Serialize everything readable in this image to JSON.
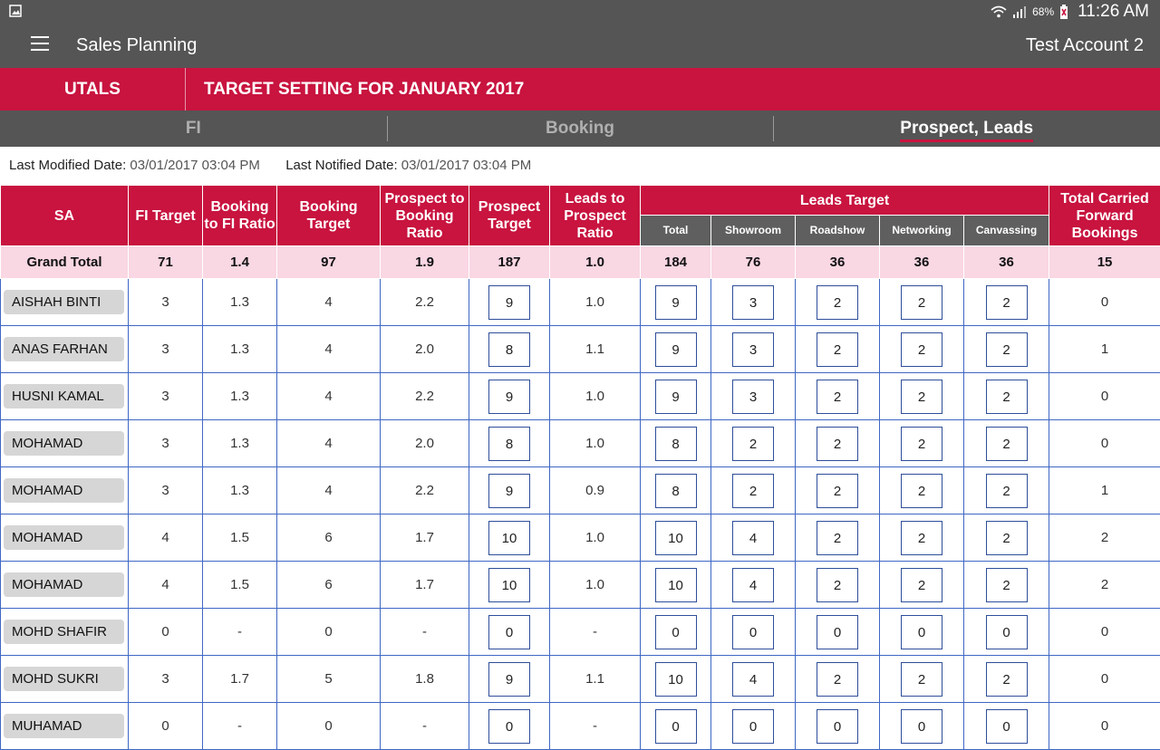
{
  "status_bar": {
    "battery": "68%",
    "time": "11:26 AM",
    "icons": [
      "image-icon",
      "wifi-icon",
      "signal-icon",
      "battery-icon"
    ]
  },
  "app_bar": {
    "menu_icon": "hamburger-menu-icon",
    "title": "Sales Planning",
    "account": "Test Account 2"
  },
  "header": {
    "left": "UTALS",
    "title": "TARGET SETTING FOR JANUARY 2017"
  },
  "tabs": [
    {
      "label": "FI"
    },
    {
      "label": "Booking"
    },
    {
      "label": "Prospect, Leads",
      "active": true
    }
  ],
  "dates": {
    "modified_label": "Last Modified Date:",
    "modified_value": "03/01/2017 03:04 PM",
    "notified_label": "Last Notified Date:",
    "notified_value": "03/01/2017 03:04 PM"
  },
  "table": {
    "columns": {
      "sa": "SA",
      "fi_target": "FI Target",
      "booking_to_fi": "Booking to FI Ratio",
      "booking_target": "Booking Target",
      "prospect_to_booking": "Prospect to Booking Ratio",
      "prospect_target": "Prospect Target",
      "leads_to_prospect": "Leads to Prospect Ratio",
      "leads_target": "Leads Target",
      "total": "Total",
      "showroom": "Showroom",
      "roadshow": "Roadshow",
      "networking": "Networking",
      "canvassing": "Canvassing",
      "carried_forward": "Total Carried Forward Bookings"
    },
    "grand_total": [
      "Grand Total",
      "71",
      "1.4",
      "97",
      "1.9",
      "187",
      "1.0",
      "184",
      "76",
      "36",
      "36",
      "36",
      "15"
    ],
    "rows": [
      [
        "AISHAH BINTI",
        "3",
        "1.3",
        "4",
        "2.2",
        "9",
        "1.0",
        "9",
        "3",
        "2",
        "2",
        "2",
        "0"
      ],
      [
        "ANAS FARHAN",
        "3",
        "1.3",
        "4",
        "2.0",
        "8",
        "1.1",
        "9",
        "3",
        "2",
        "2",
        "2",
        "1"
      ],
      [
        "HUSNI KAMAL",
        "3",
        "1.3",
        "4",
        "2.2",
        "9",
        "1.0",
        "9",
        "3",
        "2",
        "2",
        "2",
        "0"
      ],
      [
        "MOHAMAD",
        "3",
        "1.3",
        "4",
        "2.0",
        "8",
        "1.0",
        "8",
        "2",
        "2",
        "2",
        "2",
        "0"
      ],
      [
        "MOHAMAD",
        "3",
        "1.3",
        "4",
        "2.2",
        "9",
        "0.9",
        "8",
        "2",
        "2",
        "2",
        "2",
        "1"
      ],
      [
        "MOHAMAD",
        "4",
        "1.5",
        "6",
        "1.7",
        "10",
        "1.0",
        "10",
        "4",
        "2",
        "2",
        "2",
        "2"
      ],
      [
        "MOHAMAD",
        "4",
        "1.5",
        "6",
        "1.7",
        "10",
        "1.0",
        "10",
        "4",
        "2",
        "2",
        "2",
        "2"
      ],
      [
        "MOHD SHAFIR",
        "0",
        "-",
        "0",
        "-",
        "0",
        "-",
        "0",
        "0",
        "0",
        "0",
        "0",
        "0"
      ],
      [
        "MOHD SUKRI",
        "3",
        "1.7",
        "5",
        "1.8",
        "9",
        "1.1",
        "10",
        "4",
        "2",
        "2",
        "2",
        "0"
      ],
      [
        "MUHAMAD",
        "0",
        "-",
        "0",
        "-",
        "0",
        "-",
        "0",
        "0",
        "0",
        "0",
        "0",
        "0"
      ]
    ]
  }
}
